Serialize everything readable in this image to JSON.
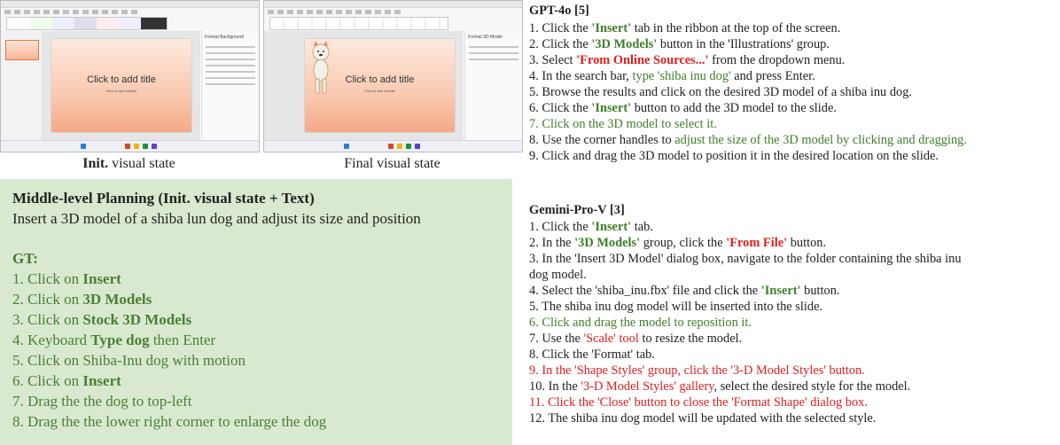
{
  "screenshots": {
    "init": {
      "slide_title": "Click to add title",
      "slide_subtitle": "Click to add subtitle",
      "panel_header": "Format Background",
      "caption_bold": "Init.",
      "caption_rest": " visual state"
    },
    "final": {
      "slide_title": "Click to add title",
      "slide_subtitle": "Click to add subtitle",
      "panel_header": "Format 3D Model",
      "caption": "Final visual state"
    }
  },
  "planning": {
    "heading": "Middle-level Planning (Init. visual state + Text)",
    "task": "Insert a 3D model of a shiba lun dog and adjust its size and position",
    "gt_label": "GT:",
    "gt_steps": [
      {
        "num": "1. ",
        "pre": "Click on ",
        "bold": "Insert",
        "post": ""
      },
      {
        "num": "2. ",
        "pre": "Click on ",
        "bold": "3D Models",
        "post": ""
      },
      {
        "num": "3. ",
        "pre": "Click on ",
        "bold": "Stock 3D Models",
        "post": ""
      },
      {
        "num": "4. ",
        "pre": "Keyboard ",
        "bold": "Type dog",
        "post": " then Enter"
      },
      {
        "num": "5. ",
        "pre": "Click on Shiba-Inu dog with motion",
        "bold": "",
        "post": ""
      },
      {
        "num": "6. ",
        "pre": "Click on ",
        "bold": "Insert",
        "post": ""
      },
      {
        "num": "7. ",
        "pre": "Drag the the dog to top-left",
        "bold": "",
        "post": ""
      },
      {
        "num": "8. ",
        "pre": "Drag the the lower right corner to enlarge the dog",
        "bold": "",
        "post": ""
      }
    ]
  },
  "gpt4o": {
    "heading": "GPT-4o [5]",
    "s1": [
      "1. Click the ",
      "'Insert'",
      " tab in the ribbon at the top of the screen."
    ],
    "s2": [
      "2. Click the ",
      "'3D Models'",
      " button in the 'Illustrations' group."
    ],
    "s3": [
      "3. Select ",
      "'From Online Sources...'",
      " from the dropdown menu."
    ],
    "s4": [
      "4. In the search bar, ",
      "type 'shiba inu dog'",
      " and press Enter."
    ],
    "s5": "5. Browse the results and click on the desired 3D model of a shiba inu dog.",
    "s6": [
      "6. Click the ",
      "'Insert'",
      " button to add the 3D model to the slide."
    ],
    "s7": "7. Click on the 3D model to select it.",
    "s8": [
      "8. Use the corner handles to ",
      "adjust the size of the 3D model by clicking and dragging."
    ],
    "s9": "9. Click and drag the 3D model to position it in the desired location on the slide."
  },
  "gemini": {
    "heading": "Gemini-Pro-V [3]",
    "s1": [
      "1. Click the ",
      "'Insert'",
      " tab."
    ],
    "s2": [
      "2. In the ",
      "'3D Models'",
      " group, click the ",
      "'From File'",
      " button."
    ],
    "s3a": "3. In the 'Insert 3D Model' dialog box, navigate to the folder containing the shiba inu",
    "s3b": "dog model.",
    "s4": [
      "4. Select the 'shiba_inu.fbx' file and click the ",
      "'Insert'",
      " button."
    ],
    "s5": "5. The shiba inu dog model will be inserted into the slide.",
    "s6": "6. Click and drag the model to reposition it.",
    "s7": [
      "7. Use the ",
      "'Scale' tool",
      " to resize the model."
    ],
    "s8": "8. Click the 'Format' tab.",
    "s9": "9. In the 'Shape Styles' group, click the '3-D Model Styles' button.",
    "s10": [
      "10. In the ",
      "'3-D Model Styles' gallery",
      ", select the desired style for the model."
    ],
    "s11": "11. Click the 'Close' button to close the 'Format Shape' dialog box.",
    "s12": "12. The shiba inu dog model will be updated with the selected style."
  },
  "colors": {
    "green_box": "#d8e9d0",
    "green_text": "#3e7f2a",
    "red_text": "#e01f1f",
    "slide_orange": "#f4aa88"
  }
}
